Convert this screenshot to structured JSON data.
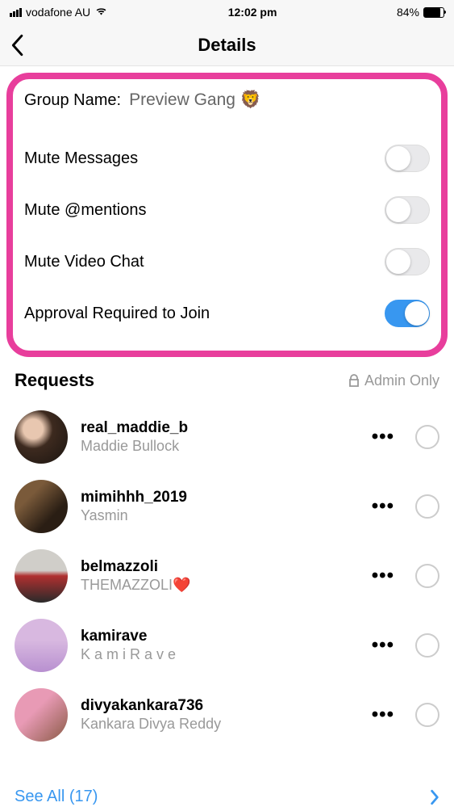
{
  "status": {
    "carrier": "vodafone AU",
    "time": "12:02 pm",
    "battery_pct": "84%",
    "battery_fill_width": "84%"
  },
  "nav": {
    "title": "Details"
  },
  "group": {
    "name_label": "Group Name:",
    "name_value": "Preview Gang 🦁"
  },
  "settings": [
    {
      "label": "Mute Messages",
      "on": false
    },
    {
      "label": "Mute @mentions",
      "on": false
    },
    {
      "label": "Mute Video Chat",
      "on": false
    },
    {
      "label": "Approval Required to Join",
      "on": true
    }
  ],
  "requests": {
    "header": "Requests",
    "admin_text": "Admin Only",
    "items": [
      {
        "username": "real_maddie_b",
        "fullname": "Maddie Bullock"
      },
      {
        "username": "mimihhh_2019",
        "fullname": "Yasmin"
      },
      {
        "username": "belmazzoli",
        "fullname": "THEMAZZOLI❤️"
      },
      {
        "username": "kamirave",
        "fullname": "K a m i  R a v e"
      },
      {
        "username": "divyakankara736",
        "fullname": "Kankara Divya Reddy"
      }
    ],
    "see_all": "See All (17)"
  }
}
